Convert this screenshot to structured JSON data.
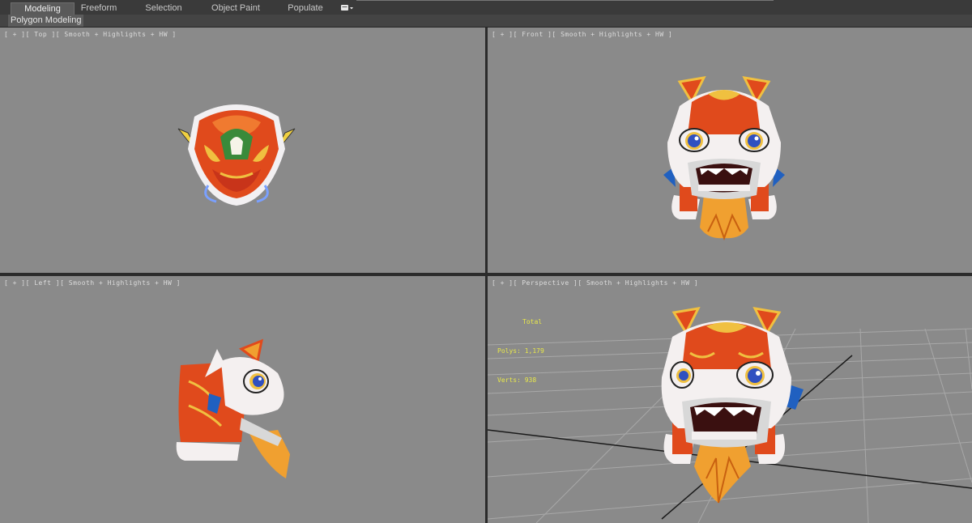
{
  "ribbon": {
    "tabs": [
      {
        "label": "Modeling",
        "active": true
      },
      {
        "label": "Freeform",
        "active": false
      },
      {
        "label": "Selection",
        "active": false
      },
      {
        "label": "Object Paint",
        "active": false
      },
      {
        "label": "Populate",
        "active": false
      }
    ],
    "menu_icon": "window-dropdown-icon"
  },
  "subbar": {
    "label": "Polygon Modeling"
  },
  "viewports": {
    "top": {
      "label": "[ + ][ Top ][ Smooth + Highlights + HW ]"
    },
    "front": {
      "label": "[ + ][ Front ][ Smooth + Highlights + HW ]"
    },
    "left": {
      "label": "[ + ][ Left ][ Smooth + Highlights + HW ]"
    },
    "perspective": {
      "label": "[ + ][ Perspective ][ Smooth + Highlights + HW ]"
    }
  },
  "stats": {
    "title": "Total",
    "polys": "Polys: 1,179",
    "verts": "Verts: 938"
  },
  "colors": {
    "viewport_bg": "#8a8a8a",
    "stats_yellow": "#e8e84a",
    "lion_red": "#e04a1c",
    "fur_white": "#f4f0f0"
  }
}
